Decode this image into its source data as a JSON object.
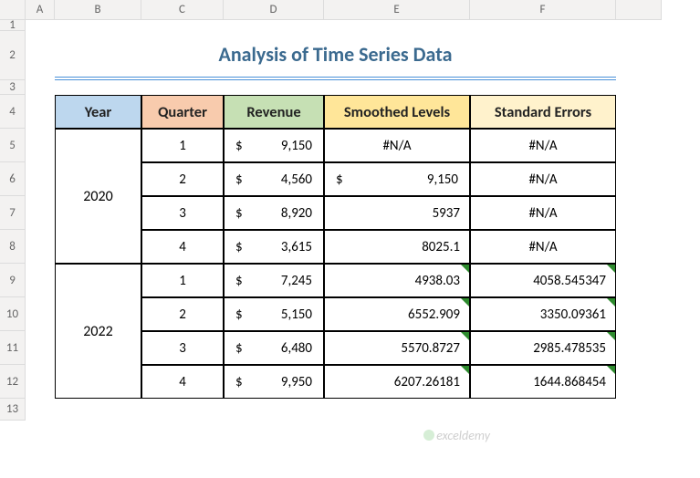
{
  "cols": [
    "A",
    "B",
    "C",
    "D",
    "E",
    "F"
  ],
  "rows": [
    "1",
    "2",
    "3",
    "4",
    "5",
    "6",
    "7",
    "8",
    "9",
    "10",
    "11",
    "12",
    "13"
  ],
  "title": "Analysis of Time Series Data",
  "headers": {
    "year": "Year",
    "quarter": "Quarter",
    "revenue": "Revenue",
    "smoothed": "Smoothed Levels",
    "stderr": "Standard Errors"
  },
  "years": [
    "2020",
    "2022"
  ],
  "currency_symbol": "$",
  "data": [
    {
      "quarter": "1",
      "revenue": "9,150",
      "smoothed": "#N/A",
      "stderr": "#N/A",
      "sm_money": false,
      "sm_center": true,
      "se_center": true
    },
    {
      "quarter": "2",
      "revenue": "4,560",
      "smoothed": "9,150",
      "stderr": "#N/A",
      "sm_money": true,
      "sm_center": false,
      "se_center": true
    },
    {
      "quarter": "3",
      "revenue": "8,920",
      "smoothed": "5937",
      "stderr": "#N/A",
      "sm_money": false,
      "sm_center": false,
      "se_center": true
    },
    {
      "quarter": "4",
      "revenue": "3,615",
      "smoothed": "8025.1",
      "stderr": "#N/A",
      "sm_money": false,
      "sm_center": false,
      "se_center": true
    },
    {
      "quarter": "1",
      "revenue": "7,245",
      "smoothed": "4938.03",
      "stderr": "4058.545347",
      "sm_money": false,
      "sm_center": false,
      "se_center": false,
      "flag": true
    },
    {
      "quarter": "2",
      "revenue": "5,150",
      "smoothed": "6552.909",
      "stderr": "3350.09361",
      "sm_money": false,
      "sm_center": false,
      "se_center": false,
      "flag": true
    },
    {
      "quarter": "3",
      "revenue": "6,480",
      "smoothed": "5570.8727",
      "stderr": "2985.478535",
      "sm_money": false,
      "sm_center": false,
      "se_center": false,
      "flag": true
    },
    {
      "quarter": "4",
      "revenue": "9,950",
      "smoothed": "6207.26181",
      "stderr": "1644.868454",
      "sm_money": false,
      "sm_center": false,
      "se_center": false,
      "flag": true
    }
  ],
  "watermark": "exceldemy",
  "chart_data": {
    "type": "table",
    "title": "Analysis of Time Series Data",
    "columns": [
      "Year",
      "Quarter",
      "Revenue",
      "Smoothed Levels",
      "Standard Errors"
    ],
    "rows": [
      [
        2020,
        1,
        9150,
        null,
        null
      ],
      [
        2020,
        2,
        4560,
        9150,
        null
      ],
      [
        2020,
        3,
        8920,
        5937,
        null
      ],
      [
        2020,
        4,
        3615,
        8025.1,
        null
      ],
      [
        2022,
        1,
        7245,
        4938.03,
        4058.545347
      ],
      [
        2022,
        2,
        5150,
        6552.909,
        3350.09361
      ],
      [
        2022,
        3,
        6480,
        5570.8727,
        2985.478535
      ],
      [
        2022,
        4,
        9950,
        6207.26181,
        1644.868454
      ]
    ]
  }
}
